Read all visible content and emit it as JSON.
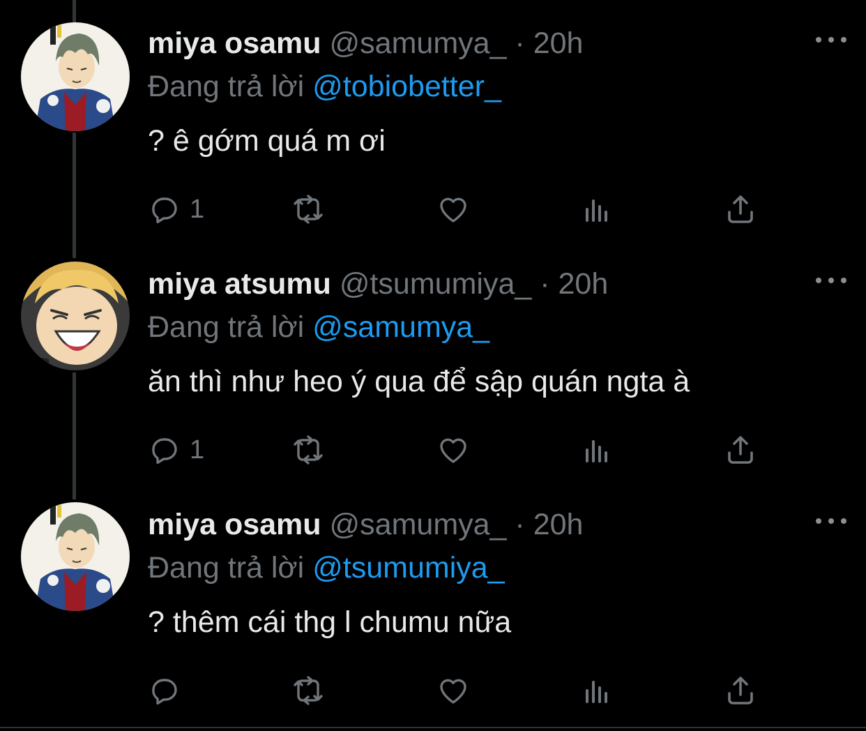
{
  "colors": {
    "background": "#000000",
    "text_primary": "#e7e9ea",
    "text_secondary": "#71767b",
    "link": "#1d9bf0",
    "thread_line": "#333639"
  },
  "tweets": [
    {
      "display_name": "miya osamu",
      "handle": "@samumya_",
      "separator": "·",
      "time": "20h",
      "reply_prefix": "Đang trả lời",
      "reply_to": "@tobiobetter_",
      "text": "? ê gớm quá m ơi",
      "reply_count": "1",
      "avatar": "osamu-avatar"
    },
    {
      "display_name": "miya atsumu",
      "handle": "@tsumumiya_",
      "separator": "·",
      "time": "20h",
      "reply_prefix": "Đang trả lời",
      "reply_to": "@samumya_",
      "text": "ăn thì như heo ý qua để sập quán ngta à",
      "reply_count": "1",
      "avatar": "atsumu-avatar"
    },
    {
      "display_name": "miya osamu",
      "handle": "@samumya_",
      "separator": "·",
      "time": "20h",
      "reply_prefix": "Đang trả lời",
      "reply_to": "@tsumumiya_",
      "text": "? thêm cái thg l chumu nữa",
      "reply_count": "",
      "avatar": "osamu-avatar"
    }
  ],
  "icons": {
    "more": "more-horizontal-icon",
    "reply": "reply-bubble-icon",
    "retweet": "retweet-icon",
    "like": "heart-icon",
    "views": "bar-chart-icon",
    "share": "share-upload-icon"
  }
}
